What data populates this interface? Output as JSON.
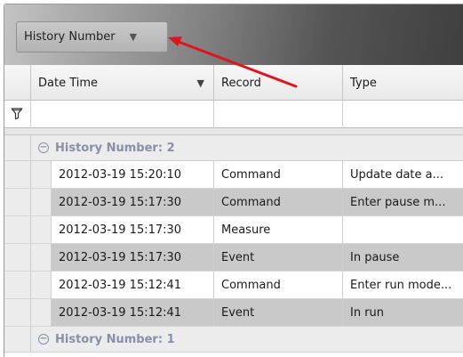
{
  "group_panel": {
    "chip_label": "History Number",
    "chip_arrow": "▼"
  },
  "columns": [
    {
      "label": "Date Time",
      "filter_arrow": "▼"
    },
    {
      "label": "Record"
    },
    {
      "label": "Type"
    }
  ],
  "groups": [
    {
      "toggle": "−",
      "label": "History Number: 2",
      "rows": [
        {
          "datetime": "2012-03-19 15:20:10",
          "record": "Command",
          "type": "Update date a..."
        },
        {
          "datetime": "2012-03-19 15:17:30",
          "record": "Command",
          "type": "Enter pause m..."
        },
        {
          "datetime": "2012-03-19 15:17:30",
          "record": "Measure",
          "type": ""
        },
        {
          "datetime": "2012-03-19 15:17:30",
          "record": "Event",
          "type": "In pause"
        },
        {
          "datetime": "2012-03-19 15:12:41",
          "record": "Command",
          "type": "Enter run mode..."
        },
        {
          "datetime": "2012-03-19 15:12:41",
          "record": "Event",
          "type": "In run"
        }
      ]
    },
    {
      "toggle": "−",
      "label": "History Number: 1",
      "rows": []
    }
  ],
  "colors": {
    "annotation_arrow": "#e0141e",
    "group_text": "#8a8fa8",
    "alt_row": "#c9c9c9"
  },
  "icons": {
    "filter_row": "funnel-icon",
    "group_toggle": "collapse-icon"
  }
}
